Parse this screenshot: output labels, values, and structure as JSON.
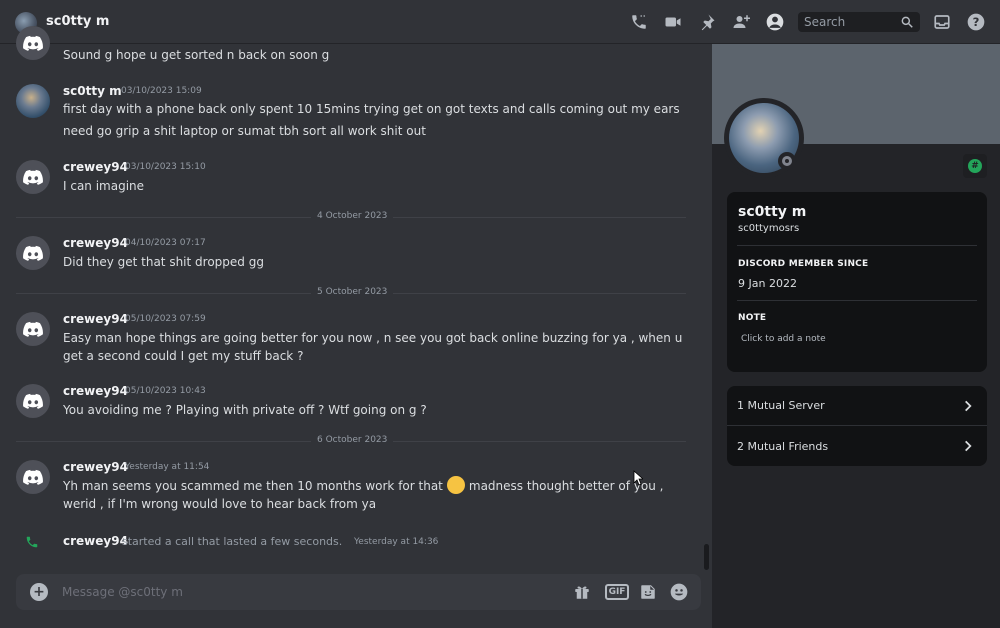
{
  "header": {
    "title": "sc0tty m",
    "search_placeholder": "Search"
  },
  "messages": [
    {
      "author": "",
      "time": "",
      "lines": [
        "Sound g hope u get sorted n back on soon g"
      ]
    },
    {
      "author": "sc0tty m",
      "time": "03/10/2023 15:09",
      "lines": [
        "first day with a phone back only spent 10 15mins trying get on got texts and calls coming out my ears",
        "need go grip a shit laptop or sumat tbh sort all work shit out"
      ]
    },
    {
      "author": "crewey94",
      "time": "03/10/2023 15:10",
      "lines": [
        "I can imagine"
      ]
    },
    {
      "author": "crewey94",
      "time": "04/10/2023 07:17",
      "lines": [
        "Did they get that shit dropped gg"
      ]
    },
    {
      "author": "crewey94",
      "time": "05/10/2023 07:59",
      "lines": [
        "Easy man hope things are going better for you now , n see you got back online  buzzing for ya , when u",
        "get a second could I get my stuff back ?"
      ]
    },
    {
      "author": "crewey94",
      "time": "05/10/2023 10:43",
      "lines": [
        "You avoiding me ? Playing with private off ? Wtf going on g ?"
      ]
    },
    {
      "author": "crewey94",
      "time": "Yesterday at 11:54",
      "lines": [
        "Yh man seems you scammed me  then 10 months work for that",
        "madness thought better of you ,",
        "werid , if I'm wrong would love to hear back from ya"
      ]
    }
  ],
  "dividers": [
    "4 October 2023",
    "5 October 2023",
    "6 October 2023"
  ],
  "call": {
    "author": "crewey94",
    "text": "started a call that lasted a few seconds.",
    "time": "Yesterday at 14:36"
  },
  "composer": {
    "placeholder": "Message @sc0tty m",
    "gif_label": "GIF"
  },
  "profile": {
    "display_name": "sc0tty m",
    "username": "sc0ttymosrs",
    "member_since_label": "DISCORD MEMBER SINCE",
    "member_since": "9 Jan 2022",
    "note_label": "NOTE",
    "note_placeholder": "Click to add a note",
    "badge_symbol": "#",
    "mutual_servers": "1 Mutual Server",
    "mutual_friends": "2 Mutual Friends"
  },
  "colors": {
    "background": "#313338",
    "panel": "#232428",
    "card": "#111214",
    "status_offline": "#80848e",
    "call_green": "#23a55a"
  },
  "icons": [
    "call-icon",
    "video-icon",
    "pin-icon",
    "add-friend-icon",
    "profile-icon",
    "search-icon",
    "inbox-icon",
    "help-icon",
    "plus-icon",
    "gift-icon",
    "gif-icon",
    "sticker-icon",
    "emoji-icon",
    "chevron-right-icon",
    "phone-icon"
  ]
}
